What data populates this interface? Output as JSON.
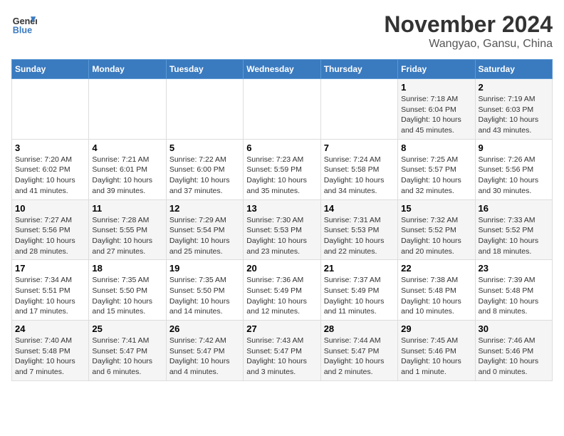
{
  "header": {
    "logo_line1": "General",
    "logo_line2": "Blue",
    "title": "November 2024",
    "subtitle": "Wangyao, Gansu, China"
  },
  "calendar": {
    "days_of_week": [
      "Sunday",
      "Monday",
      "Tuesday",
      "Wednesday",
      "Thursday",
      "Friday",
      "Saturday"
    ],
    "weeks": [
      [
        {
          "day": "",
          "info": ""
        },
        {
          "day": "",
          "info": ""
        },
        {
          "day": "",
          "info": ""
        },
        {
          "day": "",
          "info": ""
        },
        {
          "day": "",
          "info": ""
        },
        {
          "day": "1",
          "info": "Sunrise: 7:18 AM\nSunset: 6:04 PM\nDaylight: 10 hours and 45 minutes."
        },
        {
          "day": "2",
          "info": "Sunrise: 7:19 AM\nSunset: 6:03 PM\nDaylight: 10 hours and 43 minutes."
        }
      ],
      [
        {
          "day": "3",
          "info": "Sunrise: 7:20 AM\nSunset: 6:02 PM\nDaylight: 10 hours and 41 minutes."
        },
        {
          "day": "4",
          "info": "Sunrise: 7:21 AM\nSunset: 6:01 PM\nDaylight: 10 hours and 39 minutes."
        },
        {
          "day": "5",
          "info": "Sunrise: 7:22 AM\nSunset: 6:00 PM\nDaylight: 10 hours and 37 minutes."
        },
        {
          "day": "6",
          "info": "Sunrise: 7:23 AM\nSunset: 5:59 PM\nDaylight: 10 hours and 35 minutes."
        },
        {
          "day": "7",
          "info": "Sunrise: 7:24 AM\nSunset: 5:58 PM\nDaylight: 10 hours and 34 minutes."
        },
        {
          "day": "8",
          "info": "Sunrise: 7:25 AM\nSunset: 5:57 PM\nDaylight: 10 hours and 32 minutes."
        },
        {
          "day": "9",
          "info": "Sunrise: 7:26 AM\nSunset: 5:56 PM\nDaylight: 10 hours and 30 minutes."
        }
      ],
      [
        {
          "day": "10",
          "info": "Sunrise: 7:27 AM\nSunset: 5:56 PM\nDaylight: 10 hours and 28 minutes."
        },
        {
          "day": "11",
          "info": "Sunrise: 7:28 AM\nSunset: 5:55 PM\nDaylight: 10 hours and 27 minutes."
        },
        {
          "day": "12",
          "info": "Sunrise: 7:29 AM\nSunset: 5:54 PM\nDaylight: 10 hours and 25 minutes."
        },
        {
          "day": "13",
          "info": "Sunrise: 7:30 AM\nSunset: 5:53 PM\nDaylight: 10 hours and 23 minutes."
        },
        {
          "day": "14",
          "info": "Sunrise: 7:31 AM\nSunset: 5:53 PM\nDaylight: 10 hours and 22 minutes."
        },
        {
          "day": "15",
          "info": "Sunrise: 7:32 AM\nSunset: 5:52 PM\nDaylight: 10 hours and 20 minutes."
        },
        {
          "day": "16",
          "info": "Sunrise: 7:33 AM\nSunset: 5:52 PM\nDaylight: 10 hours and 18 minutes."
        }
      ],
      [
        {
          "day": "17",
          "info": "Sunrise: 7:34 AM\nSunset: 5:51 PM\nDaylight: 10 hours and 17 minutes."
        },
        {
          "day": "18",
          "info": "Sunrise: 7:35 AM\nSunset: 5:50 PM\nDaylight: 10 hours and 15 minutes."
        },
        {
          "day": "19",
          "info": "Sunrise: 7:35 AM\nSunset: 5:50 PM\nDaylight: 10 hours and 14 minutes."
        },
        {
          "day": "20",
          "info": "Sunrise: 7:36 AM\nSunset: 5:49 PM\nDaylight: 10 hours and 12 minutes."
        },
        {
          "day": "21",
          "info": "Sunrise: 7:37 AM\nSunset: 5:49 PM\nDaylight: 10 hours and 11 minutes."
        },
        {
          "day": "22",
          "info": "Sunrise: 7:38 AM\nSunset: 5:48 PM\nDaylight: 10 hours and 10 minutes."
        },
        {
          "day": "23",
          "info": "Sunrise: 7:39 AM\nSunset: 5:48 PM\nDaylight: 10 hours and 8 minutes."
        }
      ],
      [
        {
          "day": "24",
          "info": "Sunrise: 7:40 AM\nSunset: 5:48 PM\nDaylight: 10 hours and 7 minutes."
        },
        {
          "day": "25",
          "info": "Sunrise: 7:41 AM\nSunset: 5:47 PM\nDaylight: 10 hours and 6 minutes."
        },
        {
          "day": "26",
          "info": "Sunrise: 7:42 AM\nSunset: 5:47 PM\nDaylight: 10 hours and 4 minutes."
        },
        {
          "day": "27",
          "info": "Sunrise: 7:43 AM\nSunset: 5:47 PM\nDaylight: 10 hours and 3 minutes."
        },
        {
          "day": "28",
          "info": "Sunrise: 7:44 AM\nSunset: 5:47 PM\nDaylight: 10 hours and 2 minutes."
        },
        {
          "day": "29",
          "info": "Sunrise: 7:45 AM\nSunset: 5:46 PM\nDaylight: 10 hours and 1 minute."
        },
        {
          "day": "30",
          "info": "Sunrise: 7:46 AM\nSunset: 5:46 PM\nDaylight: 10 hours and 0 minutes."
        }
      ]
    ]
  }
}
